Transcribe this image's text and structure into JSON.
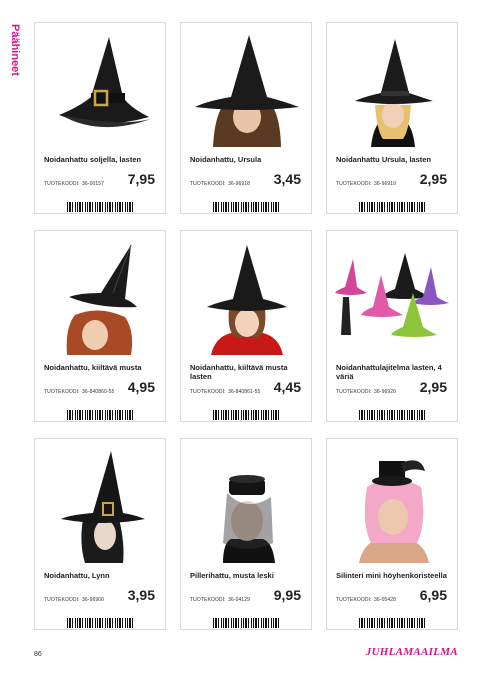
{
  "section_title": "Päähineet",
  "page_number": "86",
  "brand": "JUHLAMAAILMA",
  "code_label": "TUOTEKOODI:",
  "products": [
    {
      "name": "Noidanhattu soljella, lasten",
      "code": "36-00157",
      "price": "7,95",
      "icon": "witch-hat-buckle"
    },
    {
      "name": "Noidanhattu, Ursula",
      "code": "36-96918",
      "price": "3,45",
      "icon": "witch-hat-wig"
    },
    {
      "name": "Noidanhattu Ursula, lasten",
      "code": "36-96919",
      "price": "2,95",
      "icon": "witch-hat-child"
    },
    {
      "name": "Noidanhattu, kiiltävä musta",
      "code": "36-840860-55",
      "price": "4,95",
      "icon": "witch-hat-shiny"
    },
    {
      "name": "Noidanhattu, kiiltävä musta lasten",
      "code": "36-840861-55",
      "price": "4,45",
      "icon": "witch-hat-shiny-child"
    },
    {
      "name": "Noidanhattulajitelma lasten, 4 väriä",
      "code": "36-96920",
      "price": "2,95",
      "icon": "witch-hat-assortment"
    },
    {
      "name": "Noidanhattu, Lynn",
      "code": "36-96900",
      "price": "3,95",
      "icon": "witch-hat-lynn"
    },
    {
      "name": "Pillerihattu, musta leski",
      "code": "36-04129",
      "price": "9,95",
      "icon": "pillbox-hat-veil"
    },
    {
      "name": "Silinteri mini höyhenkoristeella",
      "code": "36-05428",
      "price": "6,95",
      "icon": "mini-top-hat"
    }
  ]
}
